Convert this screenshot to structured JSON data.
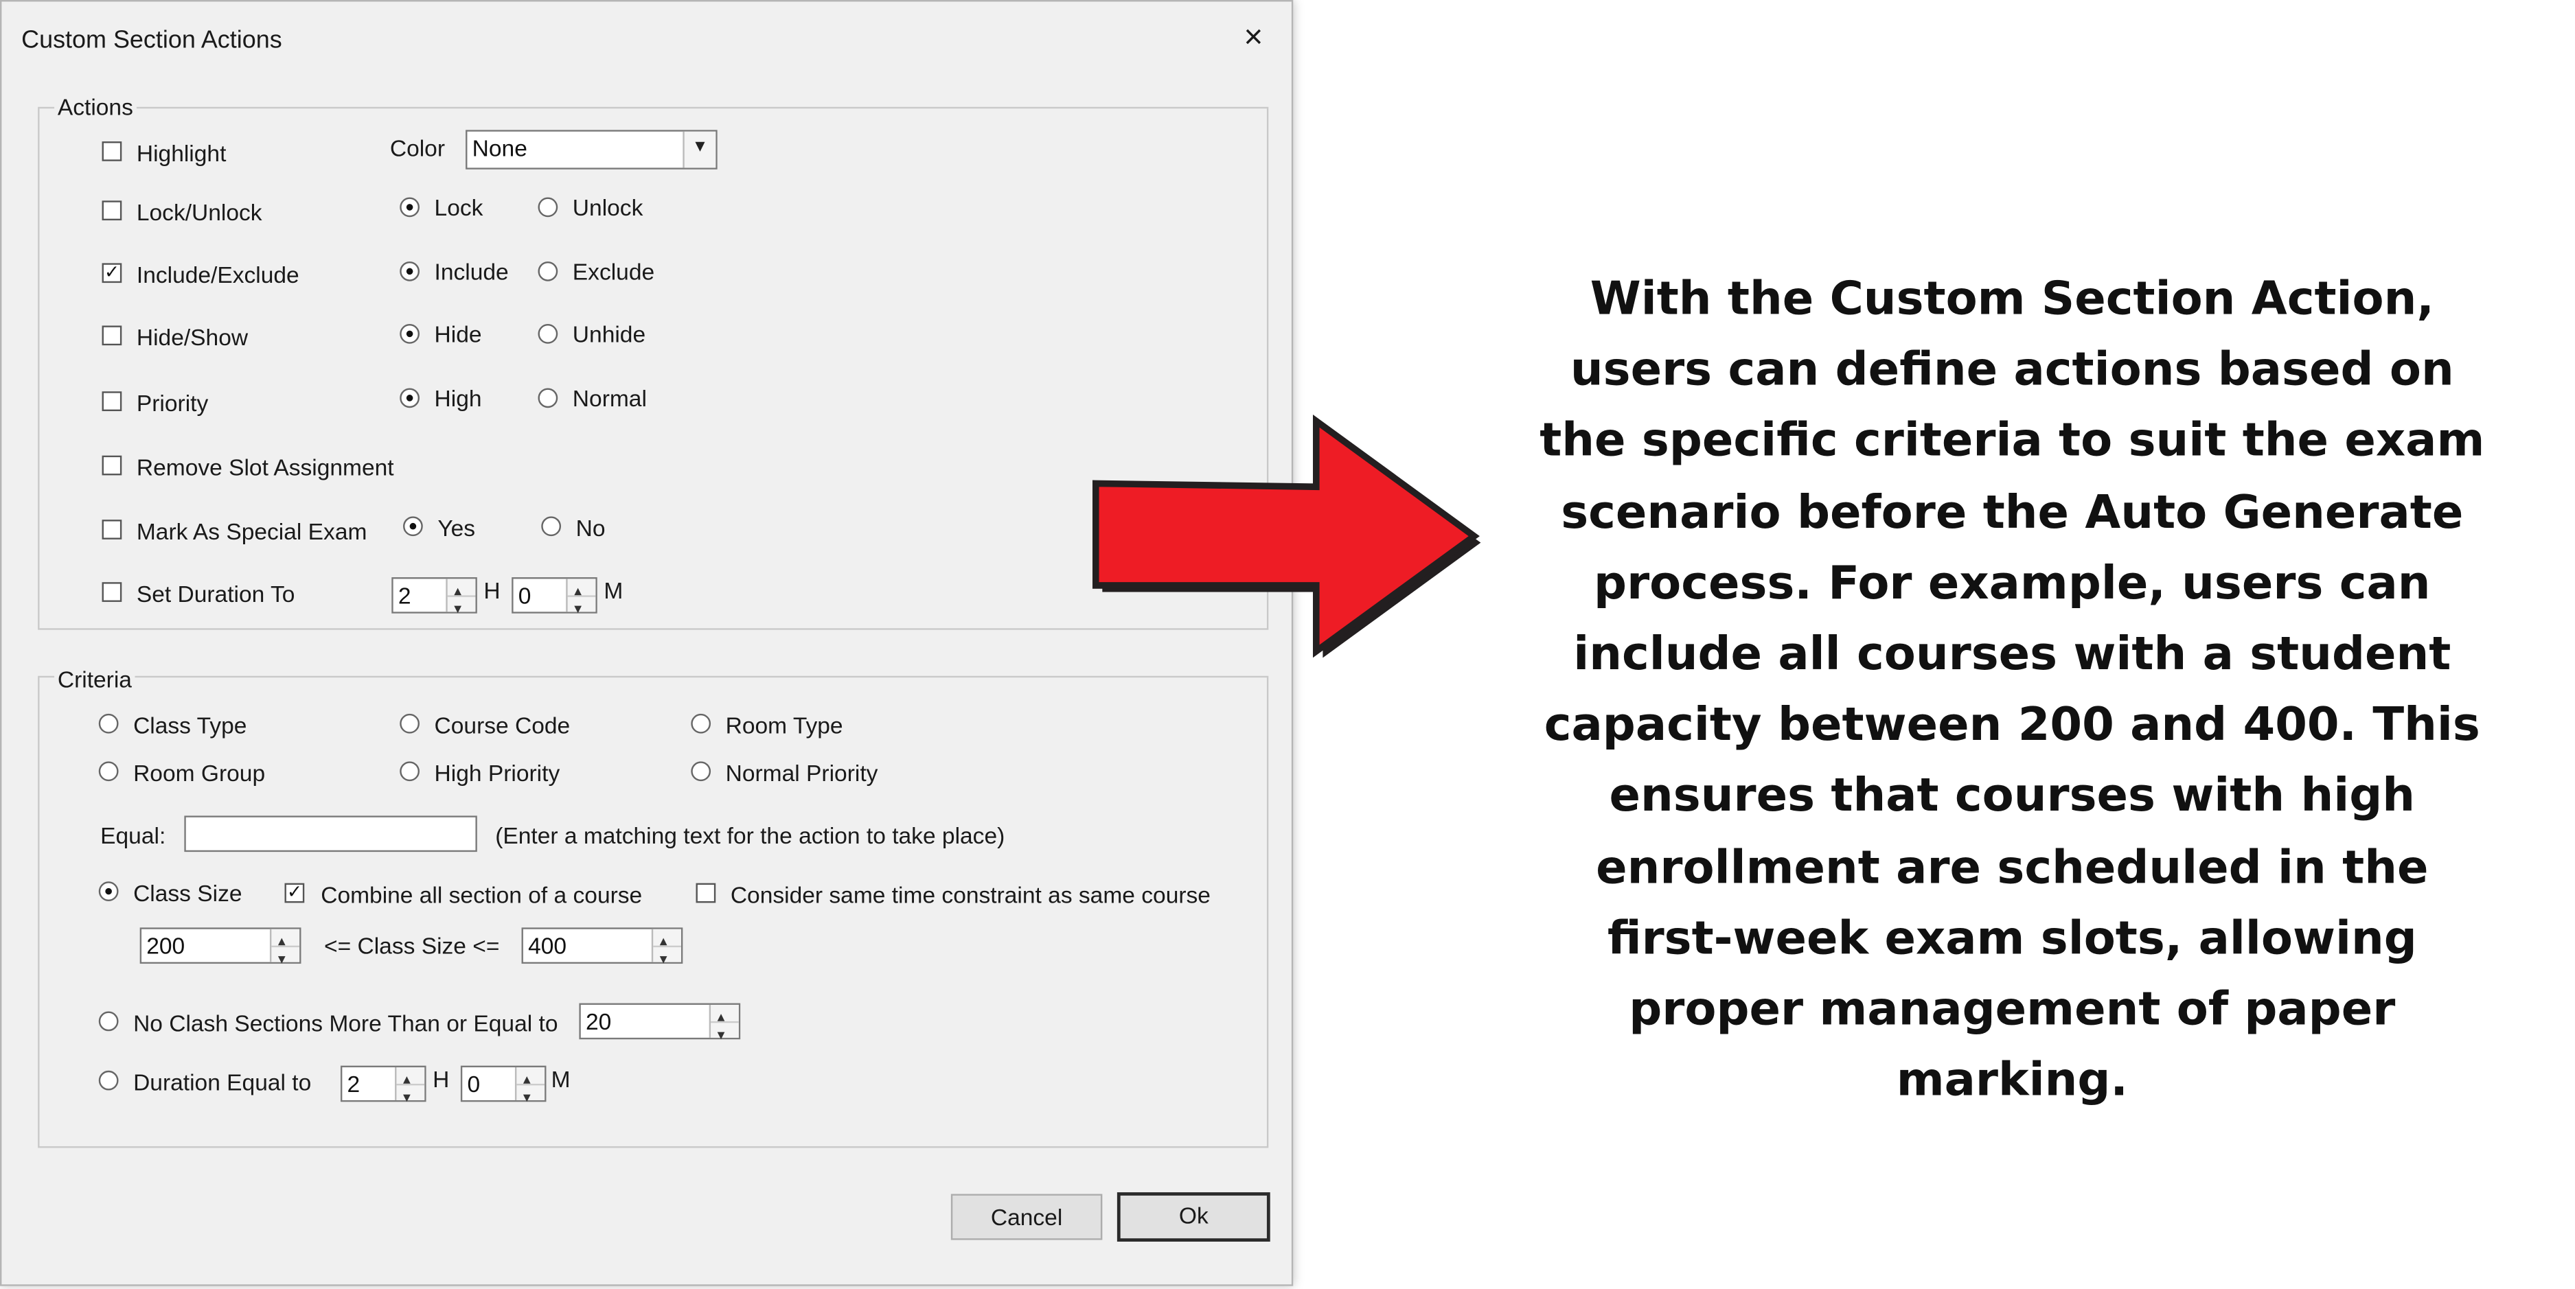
{
  "dialog": {
    "title": "Custom Section Actions",
    "close_icon": "×"
  },
  "actions": {
    "group_label": "Actions",
    "highlight_label": "Highlight",
    "highlight_checked": false,
    "color_label": "Color",
    "color_value": "None",
    "lock_unlock_label": "Lock/Unlock",
    "lock_unlock_checked": false,
    "lock_label": "Lock",
    "unlock_label": "Unlock",
    "include_exclude_label": "Include/Exclude",
    "include_exclude_checked": true,
    "include_label": "Include",
    "exclude_label": "Exclude",
    "hide_show_label": "Hide/Show",
    "hide_show_checked": false,
    "hide_label": "Hide",
    "unhide_label": "Unhide",
    "priority_label": "Priority",
    "priority_checked": false,
    "high_label": "High",
    "normal_label": "Normal",
    "remove_slot_label": "Remove Slot Assignment",
    "remove_slot_checked": false,
    "special_exam_label": "Mark As Special Exam",
    "special_exam_checked": false,
    "yes_label": "Yes",
    "no_label": "No",
    "set_duration_label": "Set Duration To",
    "set_duration_checked": false,
    "duration_hours": "2",
    "hours_unit": "H",
    "duration_minutes": "0",
    "minutes_unit": "M"
  },
  "criteria": {
    "group_label": "Criteria",
    "class_type_label": "Class Type",
    "course_code_label": "Course Code",
    "room_type_label": "Room Type",
    "room_group_label": "Room Group",
    "high_priority_label": "High Priority",
    "normal_priority_label": "Normal Priority",
    "equal_label": "Equal:",
    "equal_value": "",
    "equal_hint": "(Enter a matching text for the action to take place)",
    "class_size_label": "Class Size",
    "combine_label": "Combine all section of a course",
    "combine_checked": true,
    "consider_label": "Consider same time constraint as same course",
    "consider_checked": false,
    "size_min": "200",
    "size_between_label": "<= Class Size <=",
    "size_max": "400",
    "no_clash_label": "No Clash Sections More Than or Equal to",
    "no_clash_value": "20",
    "duration_equal_label": "Duration Equal to",
    "duration_hours": "2",
    "hours_unit": "H",
    "duration_minutes": "0",
    "minutes_unit": "M"
  },
  "buttons": {
    "cancel": "Cancel",
    "ok": "Ok"
  },
  "arrow": {
    "icon": "right-arrow-icon",
    "fill_color": "#ee1c25",
    "stroke_color": "#231f20"
  },
  "caption": {
    "text": "With the Custom Section Action, users can define actions based on the specific criteria to suit the exam scenario before the Auto Generate process. For example, users can include all courses with a student capacity between 200 and 400. This ensures that courses with high enrollment are scheduled in the first-week exam slots, allowing proper management of paper marking."
  }
}
